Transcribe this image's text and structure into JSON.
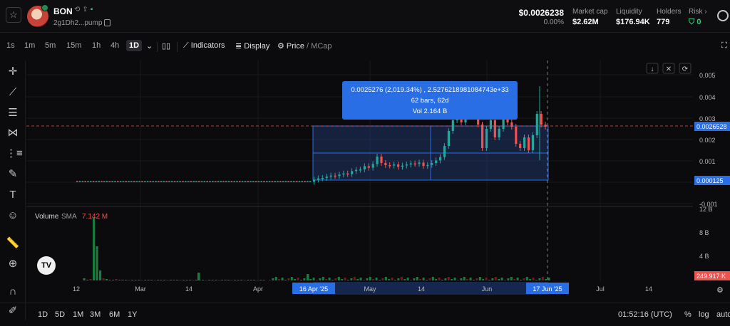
{
  "header": {
    "token_name": "BON",
    "token_address": "2g1Dh2...pump",
    "price": "$0.0026238",
    "price_change": "0.00%",
    "stats": [
      {
        "label": "Market cap",
        "value": "$2.62M"
      },
      {
        "label": "Liquidity",
        "value": "$176.94K"
      },
      {
        "label": "Holders",
        "value": "779"
      },
      {
        "label": "Risk",
        "value": "0"
      }
    ]
  },
  "toolbar": {
    "timeframes": [
      "1s",
      "1m",
      "5m",
      "15m",
      "1h",
      "4h",
      "1D"
    ],
    "active_timeframe": "1D",
    "indicators_label": "Indicators",
    "display_label": "Display",
    "price_label": "Price",
    "mcap_label": "MCap"
  },
  "tooltip": {
    "line1": "0.0025276 (2,019.34%) , 2.5276218981084743e+33",
    "line2": "62 bars, 62d",
    "line3": "Vol 2.164 B"
  },
  "volume_panel": {
    "label": "Volume",
    "sma_label": "SMA",
    "sma_value": "7.142 M"
  },
  "price_axis": {
    "ticks": [
      "0.005",
      "0.004",
      "0.003",
      "0.002",
      "0.001",
      "-0.001"
    ],
    "current_price_tag": "0.0026528",
    "range_low_tag": "0.000125",
    "volume_ticks": [
      "12 B",
      "8 B",
      "4 B"
    ],
    "volume_tag": "249.917 K"
  },
  "time_axis": {
    "labels": [
      "12",
      "Mar",
      "14",
      "Apr",
      "May",
      "14",
      "Jun",
      "Jul",
      "14"
    ],
    "range_start": "16 Apr '25",
    "range_end": "17 Jun '25"
  },
  "bottom": {
    "ranges": [
      "1D",
      "5D",
      "1M",
      "3M",
      "6M",
      "1Y"
    ],
    "clock": "01:52:16 (UTC)",
    "percent": "%",
    "log": "log",
    "auto": "auto"
  },
  "colors": {
    "up": "#26a69a",
    "down": "#ef5350",
    "accent": "#2a6ee6",
    "vol_up": "#1b7a3e"
  }
}
